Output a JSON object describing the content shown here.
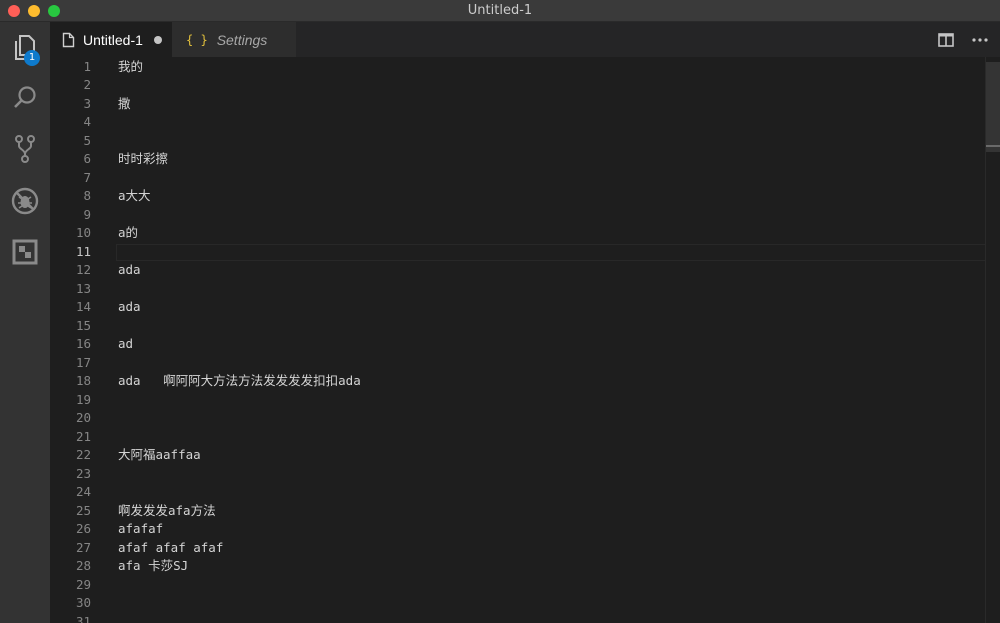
{
  "window": {
    "title": "Untitled-1",
    "traffic_lights": [
      "#ff5f57",
      "#febc2e",
      "#28c840"
    ]
  },
  "activity_bar": {
    "items": [
      {
        "name": "explorer",
        "icon": "files-icon",
        "badge": "1"
      },
      {
        "name": "search",
        "icon": "search-icon"
      },
      {
        "name": "source-control",
        "icon": "git-branch-icon"
      },
      {
        "name": "debug",
        "icon": "no-bug-icon"
      },
      {
        "name": "extensions",
        "icon": "extensions-icon"
      }
    ]
  },
  "tabs": [
    {
      "label": "Untitled-1",
      "icon": "file-icon",
      "dirty": true,
      "active": true
    },
    {
      "label": "Settings",
      "icon": "braces-icon",
      "active": false
    }
  ],
  "editor": {
    "current_line": 11,
    "lines": [
      {
        "n": "1",
        "text": "我的"
      },
      {
        "n": "2",
        "text": ""
      },
      {
        "n": "3",
        "text": "撒"
      },
      {
        "n": "4",
        "text": ""
      },
      {
        "n": "5",
        "text": ""
      },
      {
        "n": "6",
        "text": "时时彩擦"
      },
      {
        "n": "7",
        "text": ""
      },
      {
        "n": "8",
        "text": "a大大"
      },
      {
        "n": "9",
        "text": ""
      },
      {
        "n": "10",
        "text": "a的"
      },
      {
        "n": "11",
        "text": ""
      },
      {
        "n": "12",
        "text": "ada"
      },
      {
        "n": "13",
        "text": ""
      },
      {
        "n": "14",
        "text": "ada"
      },
      {
        "n": "15",
        "text": ""
      },
      {
        "n": "16",
        "text": "ad"
      },
      {
        "n": "17",
        "text": ""
      },
      {
        "n": "18",
        "text": "ada   啊阿阿大方法方法发发发发扣扣ada"
      },
      {
        "n": "19",
        "text": ""
      },
      {
        "n": "20",
        "text": ""
      },
      {
        "n": "21",
        "text": ""
      },
      {
        "n": "22",
        "text": "大阿福aaffaa"
      },
      {
        "n": "23",
        "text": ""
      },
      {
        "n": "24",
        "text": ""
      },
      {
        "n": "25",
        "text": "啊发发发afa方法"
      },
      {
        "n": "26",
        "text": "afafaf"
      },
      {
        "n": "27",
        "text": "afaf afaf afaf"
      },
      {
        "n": "28",
        "text": "afa 卡莎SJ"
      },
      {
        "n": "29",
        "text": ""
      },
      {
        "n": "30",
        "text": ""
      },
      {
        "n": "31",
        "text": ""
      }
    ]
  }
}
